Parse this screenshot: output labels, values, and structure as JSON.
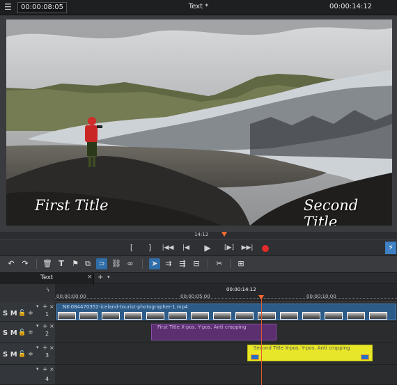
{
  "header": {
    "position_timecode": "00:00:08:05",
    "window_title": "Text *",
    "duration_timecode": "00:00:14:12"
  },
  "preview": {
    "first_title": "First Title",
    "second_title": "Second Title",
    "scrub_timecode": "14:12"
  },
  "transport": {
    "mark_in": "[",
    "mark_out": "]",
    "go_start": "|◀◀",
    "prev": "|◀",
    "play": "▶",
    "next_marker": "[▶]",
    "go_end": "▶▶|",
    "flash": "⚡"
  },
  "tabs": {
    "active": "Text",
    "close": "×",
    "add": "+",
    "menu": "▾"
  },
  "timeline": {
    "ruler_current": "00:00:14:12",
    "ruler_marks": [
      "00:00:00:00",
      "00:00:05:00",
      "00:00:10:00"
    ],
    "video_clip_name": "NK-084470352-iceland-tourist-photographer-1.mp4",
    "title_clip_1": "First Title   X-pos.  Y-pos.  Anti cropping",
    "title_clip_2": "Second Title   X-pos.  Y-pos.  Anti cropping",
    "tracks": [
      {
        "number": "1",
        "solo": "S",
        "mute": "M"
      },
      {
        "number": "2",
        "solo": "S",
        "mute": "M"
      },
      {
        "number": "3",
        "solo": "S",
        "mute": "M"
      },
      {
        "number": "4",
        "solo": "",
        "mute": ""
      }
    ]
  },
  "colors": {
    "accent_blue": "#2f6ea8",
    "playhead": "#e35a2b",
    "record": "#e52a2a",
    "title_clip_1": "#5b2f70",
    "title_clip_2": "#e8e628",
    "video_clip": "#2d5b88"
  }
}
